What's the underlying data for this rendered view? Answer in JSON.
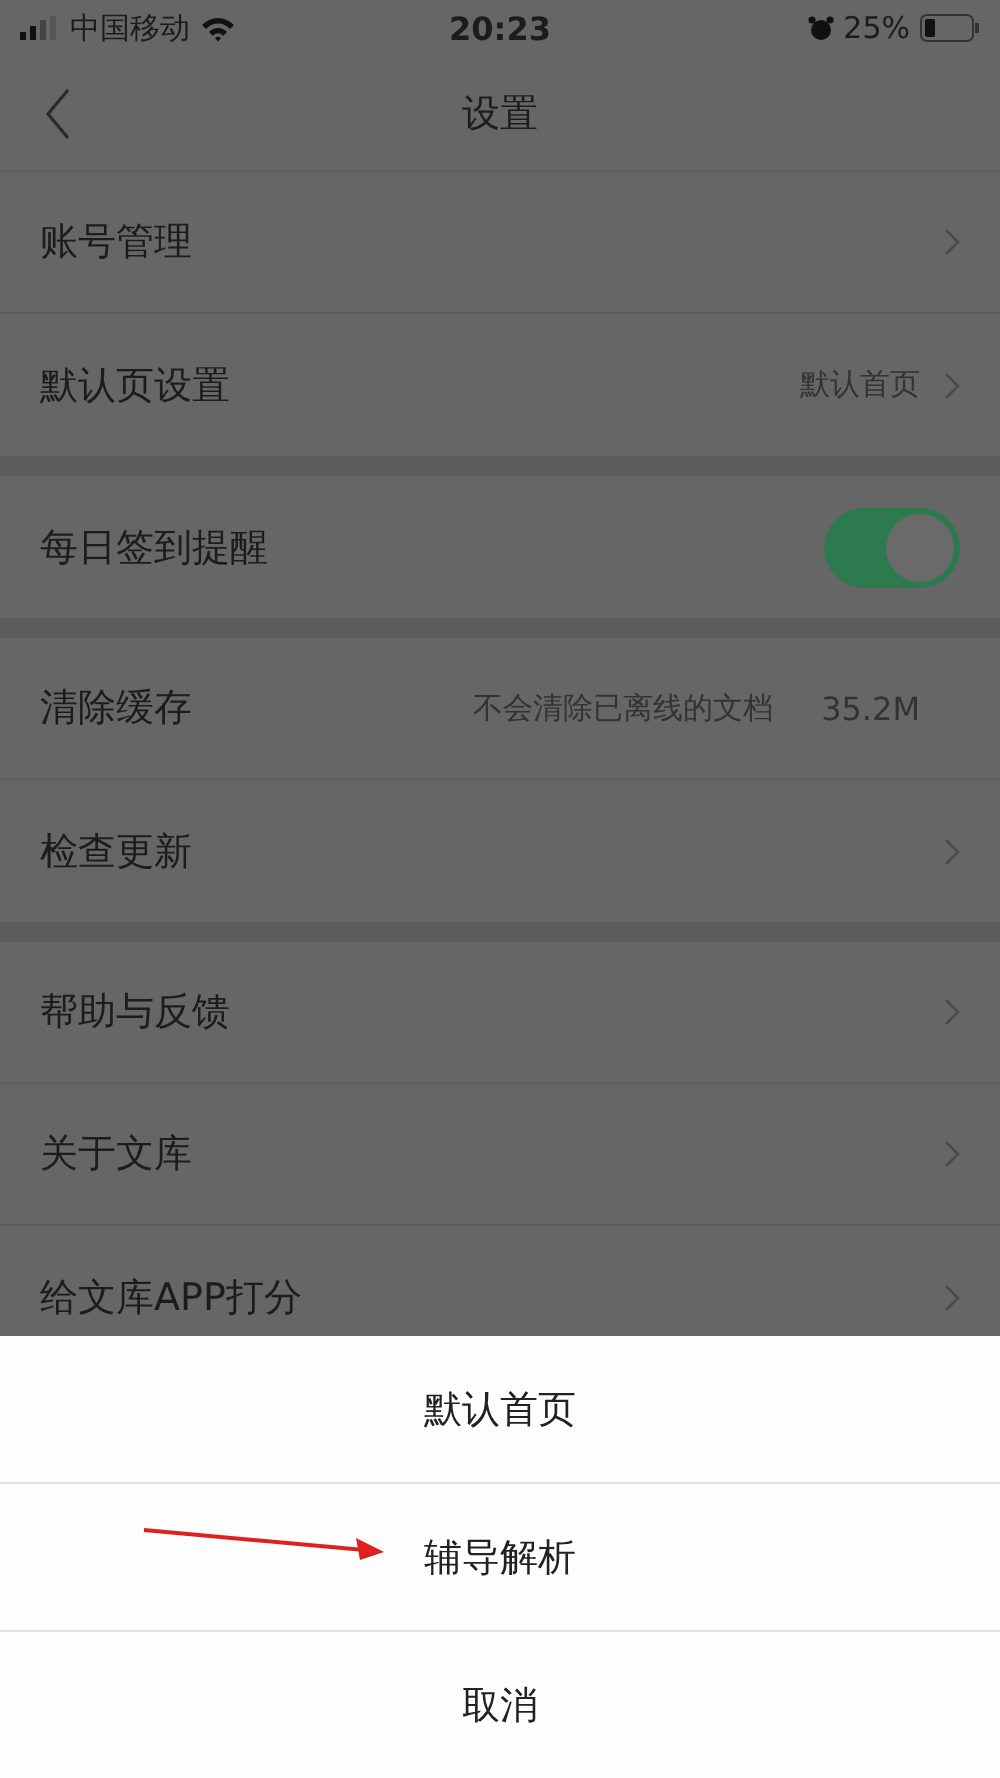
{
  "status_bar": {
    "carrier": "中国移动",
    "time": "20:23",
    "battery": "25%"
  },
  "nav": {
    "title": "设置"
  },
  "groups": [
    {
      "rows": [
        {
          "kind": "link",
          "label": "账号管理"
        },
        {
          "kind": "link",
          "label": "默认页设置",
          "value": "默认首页"
        }
      ]
    },
    {
      "rows": [
        {
          "kind": "toggle",
          "label": "每日签到提醒",
          "on": true
        }
      ]
    },
    {
      "rows": [
        {
          "kind": "info",
          "label": "清除缓存",
          "note": "不会清除已离线的文档",
          "value": "35.2M"
        },
        {
          "kind": "link",
          "label": "检查更新"
        }
      ]
    },
    {
      "rows": [
        {
          "kind": "link",
          "label": "帮助与反馈"
        },
        {
          "kind": "link",
          "label": "关于文库"
        },
        {
          "kind": "link",
          "label": "给文库APP打分"
        }
      ]
    }
  ],
  "action_sheet": {
    "options": [
      "默认首页",
      "辅导解析"
    ],
    "cancel": "取消"
  }
}
